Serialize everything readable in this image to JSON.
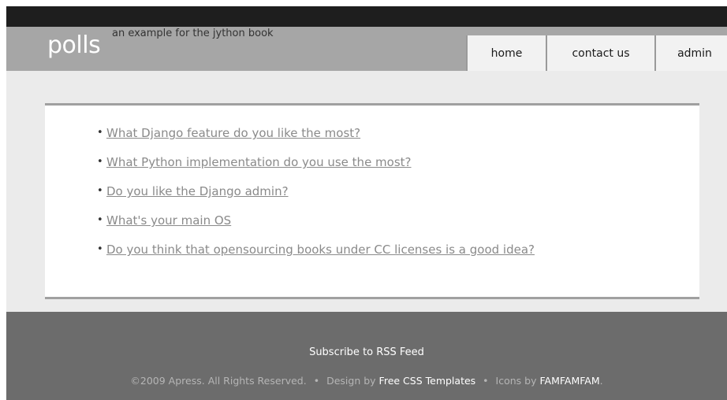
{
  "header": {
    "logo": "polls",
    "tagline": "an example for the jython book",
    "nav": [
      "home",
      "contact us",
      "admin"
    ]
  },
  "polls": [
    "What Django feature do you like the most?",
    "What Python implementation do you use the most?",
    "Do you like the Django admin?",
    "What's your main OS",
    "Do you think that opensourcing books under CC licenses is a good idea?"
  ],
  "footer": {
    "rss": "Subscribe to RSS Feed",
    "copyright": "©2009 Apress. All Rights Reserved.",
    "separator": "•",
    "design_prefix": "Design by",
    "design_link": "Free CSS Templates",
    "icons_prefix": "Icons by",
    "icons_link": "FAMFAMFAM",
    "period": "."
  },
  "colors": {
    "topbar": "#1e1e1e",
    "header": "#a6a6a6",
    "footer": "#6c6c6c",
    "link": "#8a8a8a"
  }
}
